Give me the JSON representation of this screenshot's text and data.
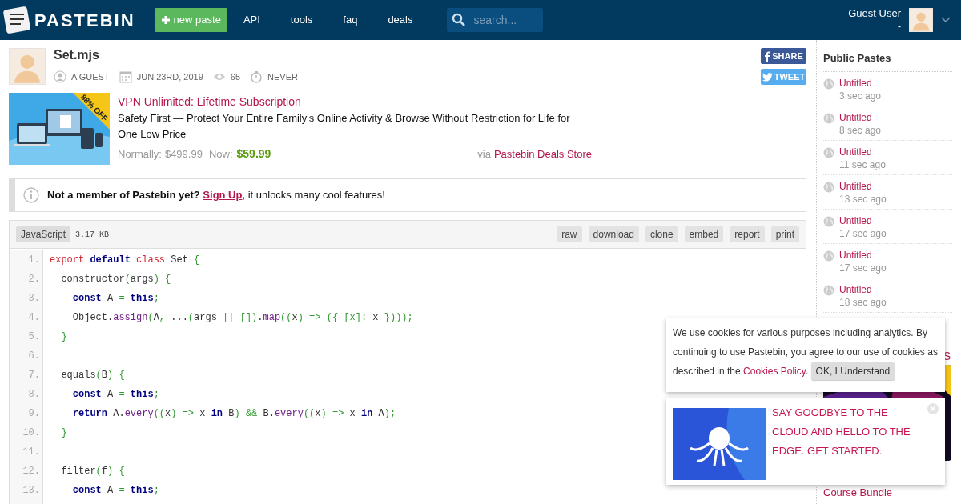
{
  "header": {
    "logo": "PASTEBIN",
    "new_paste": "new paste",
    "nav": [
      "API",
      "tools",
      "faq",
      "deals"
    ],
    "search": {
      "placeholder": "search..."
    },
    "user": {
      "name": "Guest User",
      "sub": "-"
    }
  },
  "paste": {
    "title": "Set.mjs",
    "author": "A GUEST",
    "date": "JUN 23RD, 2019",
    "views": "65",
    "expires": "NEVER",
    "share": [
      "SHARE",
      "TWEET"
    ]
  },
  "ad": {
    "badge": "88% OFF",
    "title": "VPN Unlimited: Lifetime Subscription",
    "description": "Safety First — Protect Your Entire Family's Online Activity & Browse Without Restriction for Life for One Low Price",
    "normally_label": "Normally:",
    "normal_price": "$499.99",
    "now_label": "Now:",
    "price": "$59.99",
    "via": "via",
    "store": "Pastebin Deals Store"
  },
  "notice": {
    "bold": "Not a member of Pastebin yet?",
    "link": "Sign Up",
    "rest": ", it unlocks many cool features!"
  },
  "code": {
    "language": "JavaScript",
    "size": "3.17 KB",
    "actions": [
      "raw",
      "download",
      "clone",
      "embed",
      "report",
      "print"
    ],
    "lines": [
      {
        "number": "1.",
        "tokens": [
          {
            "kind": "keyword",
            "text": "export"
          },
          {
            "kind": "bold",
            "text": " default"
          },
          {
            "kind": "keyword",
            "text": " class"
          },
          {
            "kind": "plain",
            "text": " Set"
          },
          {
            "kind": "punct",
            "text": " {"
          }
        ]
      },
      {
        "number": "2.",
        "tokens": [
          {
            "kind": "plain",
            "text": "  constructor"
          },
          {
            "kind": "punct",
            "text": "("
          },
          {
            "kind": "plain",
            "text": "args"
          },
          {
            "kind": "punct",
            "text": ") {"
          }
        ]
      },
      {
        "number": "3.",
        "tokens": [
          {
            "kind": "bold",
            "text": "    const"
          },
          {
            "kind": "plain",
            "text": " A"
          },
          {
            "kind": "punct",
            "text": " ="
          },
          {
            "kind": "bold",
            "text": " this"
          },
          {
            "kind": "punct",
            "text": ";"
          }
        ]
      },
      {
        "number": "4.",
        "tokens": [
          {
            "kind": "plain",
            "text": "    Object."
          },
          {
            "kind": "function",
            "text": "assign"
          },
          {
            "kind": "punct",
            "text": "("
          },
          {
            "kind": "plain",
            "text": "A"
          },
          {
            "kind": "punct",
            "text": ","
          },
          {
            "kind": "plain",
            "text": " ..."
          },
          {
            "kind": "punct",
            "text": "("
          },
          {
            "kind": "plain",
            "text": "args"
          },
          {
            "kind": "punct",
            "text": " || [])"
          },
          {
            "kind": "plain",
            "text": "."
          },
          {
            "kind": "function",
            "text": "map"
          },
          {
            "kind": "punct",
            "text": "(("
          },
          {
            "kind": "plain",
            "text": "x"
          },
          {
            "kind": "punct",
            "text": ") => ({ [x]:"
          },
          {
            "kind": "plain",
            "text": " x"
          },
          {
            "kind": "punct",
            "text": " })));"
          }
        ]
      },
      {
        "number": "5.",
        "tokens": [
          {
            "kind": "punct",
            "text": "  }"
          }
        ]
      },
      {
        "number": "6."
      },
      {
        "number": "7.",
        "tokens": [
          {
            "kind": "plain",
            "text": "  equals"
          },
          {
            "kind": "punct",
            "text": "("
          },
          {
            "kind": "plain",
            "text": "B"
          },
          {
            "kind": "punct",
            "text": ") {"
          }
        ]
      },
      {
        "number": "8.",
        "tokens": [
          {
            "kind": "bold",
            "text": "    const"
          },
          {
            "kind": "plain",
            "text": " A"
          },
          {
            "kind": "punct",
            "text": " ="
          },
          {
            "kind": "bold",
            "text": " this"
          },
          {
            "kind": "punct",
            "text": ";"
          }
        ]
      },
      {
        "number": "9.",
        "tokens": [
          {
            "kind": "bold",
            "text": "    return"
          },
          {
            "kind": "plain",
            "text": " A."
          },
          {
            "kind": "function",
            "text": "every"
          },
          {
            "kind": "punct",
            "text": "(("
          },
          {
            "kind": "plain",
            "text": "x"
          },
          {
            "kind": "punct",
            "text": ") =>"
          },
          {
            "kind": "plain",
            "text": " x"
          },
          {
            "kind": "bold",
            "text": " in"
          },
          {
            "kind": "plain",
            "text": " B"
          },
          {
            "kind": "punct",
            "text": ") &&"
          },
          {
            "kind": "plain",
            "text": " B."
          },
          {
            "kind": "function",
            "text": "every"
          },
          {
            "kind": "punct",
            "text": "(("
          },
          {
            "kind": "plain",
            "text": "x"
          },
          {
            "kind": "punct",
            "text": ") =>"
          },
          {
            "kind": "plain",
            "text": " x"
          },
          {
            "kind": "bold",
            "text": " in"
          },
          {
            "kind": "plain",
            "text": " A"
          },
          {
            "kind": "punct",
            "text": ");"
          }
        ]
      },
      {
        "number": "10.",
        "tokens": [
          {
            "kind": "punct",
            "text": "  }"
          }
        ]
      },
      {
        "number": "11."
      },
      {
        "number": "12.",
        "tokens": [
          {
            "kind": "plain",
            "text": "  filter"
          },
          {
            "kind": "punct",
            "text": "("
          },
          {
            "kind": "plain",
            "text": "f"
          },
          {
            "kind": "punct",
            "text": ") {"
          }
        ]
      },
      {
        "number": "13.",
        "tokens": [
          {
            "kind": "bold",
            "text": "    const"
          },
          {
            "kind": "plain",
            "text": " A"
          },
          {
            "kind": "punct",
            "text": " ="
          },
          {
            "kind": "bold",
            "text": " this"
          },
          {
            "kind": "punct",
            "text": ";"
          }
        ]
      }
    ]
  },
  "sidebar": {
    "title": "Public Pastes",
    "items": [
      {
        "title": "Untitled",
        "time": "3 sec ago"
      },
      {
        "title": "Untitled",
        "time": "8 sec ago"
      },
      {
        "title": "Untitled",
        "time": "11 sec ago"
      },
      {
        "title": "Untitled",
        "time": "13 sec ago"
      },
      {
        "title": "Untitled",
        "time": "17 sec ago"
      },
      {
        "title": "Untitled",
        "time": "17 sec ago"
      },
      {
        "title": "Untitled",
        "time": "18 sec ago"
      }
    ],
    "ad_fragment": "S",
    "ad_caption": "Course Bundle"
  },
  "cookie": {
    "text": "We use cookies for various purposes including analytics. By continuing to use Pastebin, you agree to our use of cookies as described in the",
    "link": "Cookies Policy",
    "after": ".",
    "button": "OK, I Understand"
  },
  "promo": {
    "text": "SAY GOODBYE TO THE CLOUD AND HELLO TO THE EDGE. GET STARTED."
  }
}
